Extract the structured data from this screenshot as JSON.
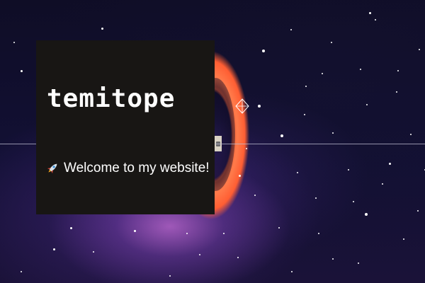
{
  "hero": {
    "brand_name": "temitope",
    "welcome_text": "Welcome to my website!",
    "welcome_icon": "rocket-icon"
  },
  "colors": {
    "card_background": "#181614",
    "ring_accent": "#ff6a3d",
    "text": "#ffffff",
    "space_background": "#0f0d26"
  }
}
